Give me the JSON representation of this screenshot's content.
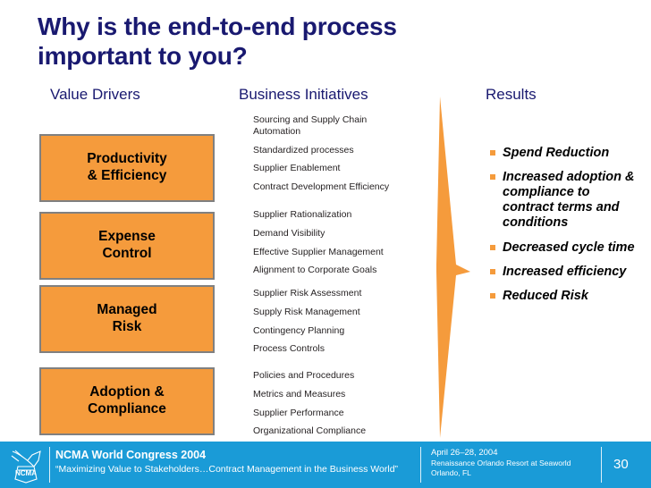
{
  "slide": {
    "title": "Why is the end-to-end process important to you?",
    "background": "#ffffff",
    "accent_orange": "#F59B3C",
    "title_color": "#191970",
    "footer_blue": "#1A9BD7"
  },
  "columns": {
    "value_drivers_heading": "Value Drivers",
    "business_initiatives_heading": "Business Initiatives",
    "results_heading": "Results"
  },
  "value_drivers": [
    {
      "label": "Productivity\n& Efficiency"
    },
    {
      "label": "Expense\nControl"
    },
    {
      "label": "Managed\nRisk"
    },
    {
      "label": "Adoption &\nCompliance"
    }
  ],
  "business_initiatives": [
    {
      "items": [
        "Sourcing and Supply Chain\nAutomation",
        "Standardized processes",
        "Supplier Enablement",
        "Contract Development Efficiency"
      ]
    },
    {
      "items": [
        "Supplier Rationalization",
        "Demand Visibility",
        "Effective Supplier Management",
        "Alignment to Corporate Goals"
      ]
    },
    {
      "items": [
        "Supplier Risk Assessment",
        "Supply Risk Management",
        "Contingency Planning",
        "Process Controls"
      ]
    },
    {
      "items": [
        "Policies and Procedures",
        "Metrics and Measures",
        "Supplier Performance",
        "Organizational Compliance"
      ]
    }
  ],
  "results": [
    "Spend Reduction",
    "Increased adoption & compliance to contract terms and conditions",
    "Decreased cycle time",
    "Increased efficiency",
    "Reduced Risk"
  ],
  "footer": {
    "logo_text": "NCMA",
    "congress_title": "NCMA World Congress 2004",
    "congress_tagline": "“Maximizing Value to Stakeholders…Contract Management in the Business World”",
    "event_date": "April 26–28, 2004",
    "venue": "Renaissance Orlando Resort at Seaworld",
    "city": "Orlando, FL",
    "page_number": "30"
  }
}
